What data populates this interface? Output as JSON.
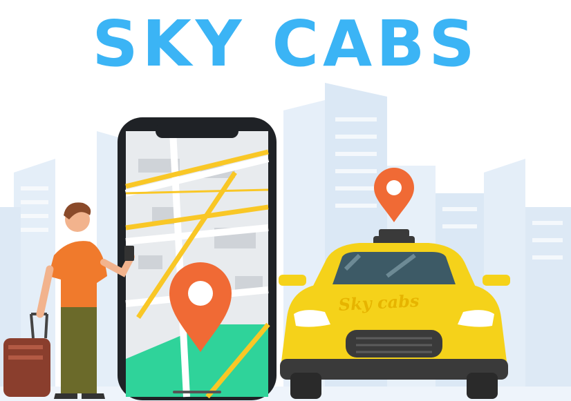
{
  "header": {
    "title": "SKY CABS"
  },
  "illustration": {
    "car_label": "Sky cabs",
    "icons": [
      "map-pin-icon",
      "location-pin-icon",
      "taxi-icon",
      "smartphone-icon",
      "suitcase-icon"
    ],
    "colors": {
      "title": "#3bb4f5",
      "taxi": "#f5d21a",
      "pin": "#f06a35",
      "buildings": "#dbe9f6"
    }
  }
}
